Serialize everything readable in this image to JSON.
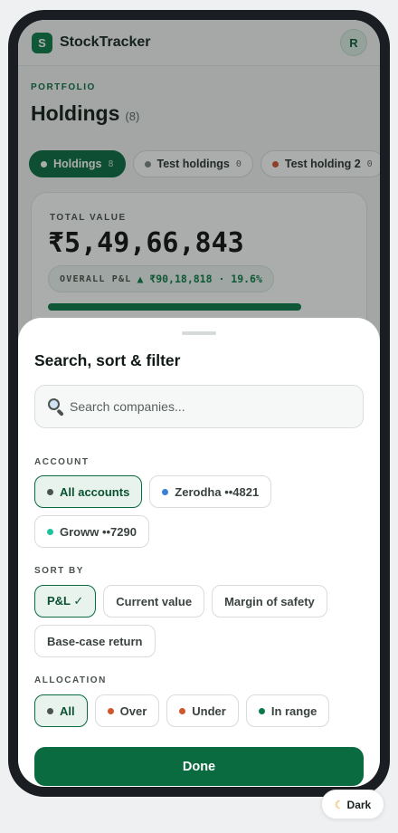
{
  "app": {
    "logo_letter": "S",
    "name": "StockTracker",
    "avatar_initial": "R"
  },
  "page": {
    "kicker": "PORTFOLIO",
    "title": "Holdings",
    "count": "(8)"
  },
  "tabs": [
    {
      "label": "Holdings",
      "count": "8",
      "active": true
    },
    {
      "label": "Test holdings",
      "count": "0",
      "active": false
    },
    {
      "label": "Test holding 2",
      "count": "0",
      "active": false
    }
  ],
  "summary": {
    "label": "TOTAL VALUE",
    "value": "₹5,49,66,843",
    "pl_label": "OVERALL P&L",
    "pl_value": "▲ ₹90,18,818 · 19.6%"
  },
  "sheet": {
    "title": "Search, sort & filter",
    "search_placeholder": "Search companies...",
    "account_label": "ACCOUNT",
    "accounts": [
      {
        "label": "All accounts",
        "color": "#4b5350",
        "selected": true
      },
      {
        "label": "Zerodha ••4821",
        "color": "#3b7fd9",
        "selected": false
      },
      {
        "label": "Groww ••7290",
        "color": "#1cc39b",
        "selected": false
      }
    ],
    "sort_label": "SORT BY",
    "sort_options": [
      {
        "label": "P&L ✓",
        "selected": true
      },
      {
        "label": "Current value",
        "selected": false
      },
      {
        "label": "Margin of safety",
        "selected": false
      },
      {
        "label": "Base-case return",
        "selected": false
      }
    ],
    "allocation_label": "ALLOCATION",
    "allocations": [
      {
        "label": "All",
        "color": "#4b5350",
        "selected": true
      },
      {
        "label": "Over",
        "color": "#d1552d",
        "selected": false
      },
      {
        "label": "Under",
        "color": "#d1552d",
        "selected": false
      },
      {
        "label": "In range",
        "color": "#0a7a48",
        "selected": false
      }
    ],
    "done_label": "Done"
  },
  "theme_toggle": {
    "icon": "moon-icon",
    "label": "Dark"
  }
}
